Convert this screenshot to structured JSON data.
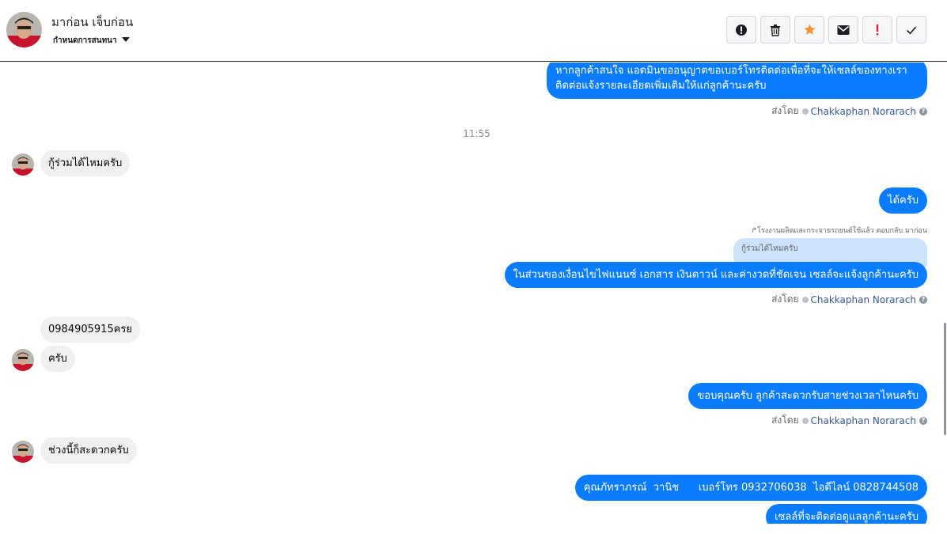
{
  "header": {
    "contact_name": "มาก่อน เจ็บก่อน",
    "conversation_status": "กำหนดการสนทนา",
    "actions": [
      {
        "icon": "alert-circle-icon",
        "name": "mark-spam-button"
      },
      {
        "icon": "trash-icon",
        "name": "delete-button"
      },
      {
        "icon": "star-icon",
        "name": "star-button"
      },
      {
        "icon": "envelope-icon",
        "name": "mark-unread-button"
      },
      {
        "icon": "exclamation-icon",
        "name": "mark-important-button"
      },
      {
        "icon": "check-icon",
        "name": "mark-done-button"
      }
    ],
    "colors": {
      "star": "#f7923b",
      "exclamation": "#e41e3f"
    }
  },
  "chat": {
    "colors": {
      "outgoing": "#0a7cff",
      "incoming": "#f0f0f0"
    },
    "sent_by_prefix": "ส่งโดย",
    "agent_name": "Chakkaphan Norarach",
    "msg1_line1": "หากลูกค้าสนใจ แอดมินขออนุญาตขอเบอร์โทรติดต่อเพื่อที่จะให้เซลล์ของทางเรา",
    "msg1_line2": "ติดต่อแจ้งรายละเอียดเพิ่มเติมให้แก่ลูกค้านะครับ",
    "time_separator": "11:55",
    "msg2": "กู้ร่วมได้ไหมครับ",
    "msg3": "ได้ครับ",
    "reply_note": "↱โรงงานผลิตและกระจายรถยนต์ใช้แล้ว ตอบกลับ มาก่อน",
    "quoted_text": "กู้ร่วมได้ไหมครับ",
    "msg4": "ในส่วนของเงื่อนไขไฟแนนซ์ เอกสาร เงินดาวน์ และค่างวดที่ชัดเจน เซลล์จะแจ้งลูกค้านะครับ",
    "msg5": "0984905915ครย",
    "msg6": "ครับ",
    "msg7": "ขอบคุณครับ ลูกค้าสะดวกรับสายช่วงเวลาไหนครับ",
    "msg8": "ช่วงนี้ก็สะดวกครับ",
    "msg9": "คุณภัทราภรณ์  วานิช      เบอร์โทร 0932706038  ไอดีไลน์ 0828744508",
    "msg10": "เซลล์ที่จะติดต่อดูแลลูกค้านะครับ"
  }
}
